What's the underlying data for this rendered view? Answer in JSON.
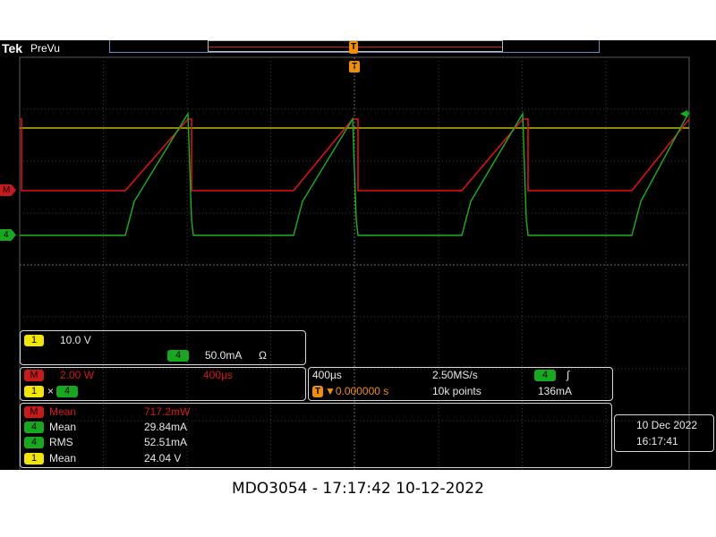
{
  "brand": "Tek",
  "mode": "PreVu",
  "trigger_marker": "T",
  "markers": {
    "math": "M",
    "ch4": "4"
  },
  "channels": {
    "ch1": {
      "badge": "1",
      "scale": "10.0 V"
    },
    "ch4": {
      "badge": "4",
      "scale": "50.0mA",
      "unit_symbol": "Ω"
    },
    "math": {
      "badge": "M",
      "scale": "2.00 W",
      "timebase": "400µs",
      "expr_a": "1",
      "expr_op": "×",
      "expr_b": "4"
    }
  },
  "horizontal": {
    "timebase": "400µs",
    "sample_rate": "2.50MS/s",
    "trigger_pos": "▼0.000000 s",
    "trigger_icon": "T",
    "record_length": "10k points",
    "trigger_channel": "4",
    "trigger_slope": "∫",
    "trigger_level": "136mA"
  },
  "measurements": [
    {
      "badge": "M",
      "label": "Mean",
      "value": "717.2mW",
      "color": "red"
    },
    {
      "badge": "4",
      "label": "Mean",
      "value": "29.84mA",
      "color": "green"
    },
    {
      "badge": "4",
      "label": "RMS",
      "value": "52.51mA",
      "color": "green"
    },
    {
      "badge": "1",
      "label": "Mean",
      "value": "24.04 V",
      "color": "yellow"
    }
  ],
  "datetime": {
    "date": "10 Dec  2022",
    "time": "16:17:41"
  },
  "footer": "MDO3054 - 17:17:42   10-12-2022",
  "colors": {
    "ch1": "#e4e400",
    "ch4": "#16b41e",
    "math": "#e01010",
    "grid": "#4a4a4a",
    "frame": "#5a78a8"
  }
}
